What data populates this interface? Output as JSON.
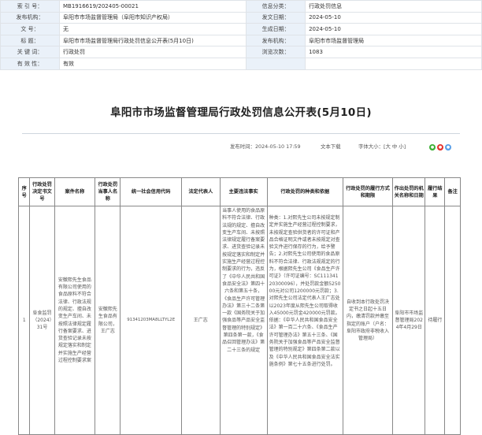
{
  "meta": [
    {
      "label_left": "索 引 号：",
      "value_left": "MB1916619/202405-00021",
      "label_right": "信息分类：",
      "value_right": "行政处罚信息"
    },
    {
      "label_left": "发布机构：",
      "value_left": "阜阳市市场监督管理局（阜阳市知识产权局）",
      "label_right": "发文日期：",
      "value_right": "2024-05-10"
    },
    {
      "label_left": "文    号：",
      "value_left": "无",
      "label_right": "生成日期：",
      "value_right": "2024-05-10"
    },
    {
      "label_left": "标    题：",
      "value_left": "阜阳市市场监督管理局行政处罚信息公开表(5月10日)",
      "label_right": "发布机构：",
      "value_right": "阜阳市市场监督管理局"
    },
    {
      "label_left": "关 键 词：",
      "value_left": "行政处罚",
      "label_right": "浏览次数：",
      "value_right": "1083"
    },
    {
      "label_left": "有 效 性：",
      "value_left": "有效",
      "label_right": "",
      "value_right": ""
    }
  ],
  "title": "阜阳市市场监督管理局行政处罚信息公开表(5月10日)",
  "toolbar": {
    "publish_time": "发布时间：2024-05-10 17:59",
    "download": "文本下载",
    "font_size": "字体大小：[大 中 小]"
  },
  "table": {
    "headers": [
      "序号",
      "行政处罚决定书文号",
      "案件名称",
      "行政处罚当事人名称",
      "统一社会信用代码",
      "法定代表人",
      "主要违法事实",
      "行政处罚的种类和依据",
      "行政处罚的履行方式和期限",
      "作出处罚的机关名称和日期",
      "履行结果",
      "备注"
    ],
    "row": {
      "index": "1",
      "doc_no": "阜食监罚（2024）31号",
      "case_name": "安徽熙先生食品有限公司使用的食品原料不符合法律、行政法规的规定、擅自改变生产车间、未按照法律规定履行备案要求、进货查验记录未按规定落实和制定并实施生产经营过程控制要求案",
      "party_name": "安徽熙先生食品有限公司，王广志",
      "credit_code": "91341203MA8LLTYL2E",
      "legal_rep": "王广志",
      "facts": "当事人使用的食品原料不符合法律、行政法规的规定、擅自改变生产车间、未按照法律规定履行备案要求、进货查验记录未按规定落实和制定并实施生产经营过程控制要求的行为，违反了《中华人民共和国食品安全法》第四十六条和第五十条，《食品生产许可管理办法》第三十二条第一款《国务院关于加强食品等产品安全监督管理的特别规定》第四条第一款，《食品召回管理办法》第二十三条的规定",
      "penalty": "种类：1.对熙先生公司未按规定制定并实施生产经营过程控制要求，未按规定查验供货者的许可证和产品合格证明文件或者未按规定对查验文件进行保存的行为，给予警告；2.对熙先生公司使用的食品原料不符合法律、行政法规规定的行为，根据熙先生公司《食品生产许可证》（许可证编号：SC11134120300096），并处罚款金额525000元对公司1200000元罚款；3.对熙先生公司法定代表人王广志处以2023年度从熙先生公司取得收入45000元罚金420000元罚款。依据：《中华人民共和国食品安全法》第一百二十六条、《食品生产许可管理办法》第五十三条、《国务院关于加强食品等产品安全监督管理的特别规定》第四条第二款以及《中华人民共和国食品安全法实施条例》第七十五条进行处罚。",
      "execution": "自收到本行政处罚决定书之日起十五日内，缴清罚款并缴至指定的账户（户名：阜阳市政府非税收入管理局）",
      "authority": "阜阳市市场监督管理局2024年4月29日",
      "result": "待履行",
      "remark": ""
    }
  }
}
